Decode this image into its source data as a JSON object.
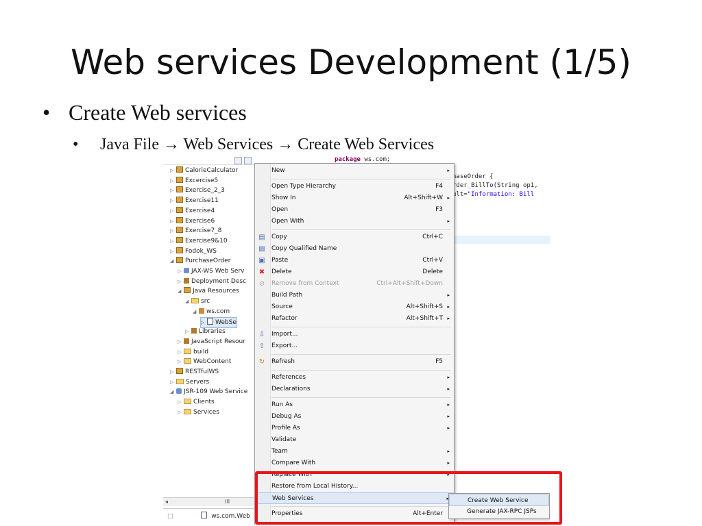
{
  "slide": {
    "title": "Web services Development (1/5)",
    "bullet1": "Create Web services",
    "bullet2": "Java File → Web Services → Create Web Services",
    "bullet_symbol": "•"
  },
  "explorer": {
    "items": [
      {
        "label": "CalorieCalculator",
        "icon": "project-icon",
        "indent": 0,
        "twisty": "▷"
      },
      {
        "label": "Excercise5",
        "icon": "project-icon",
        "indent": 0,
        "twisty": "▷"
      },
      {
        "label": "Exercise_2_3",
        "icon": "project-icon",
        "indent": 0,
        "twisty": "▷"
      },
      {
        "label": "Exercise11",
        "icon": "project-icon",
        "indent": 0,
        "twisty": "▷"
      },
      {
        "label": "Exercise4",
        "icon": "project-icon",
        "indent": 0,
        "twisty": "▷"
      },
      {
        "label": "Exercise6",
        "icon": "project-icon",
        "indent": 0,
        "twisty": "▷"
      },
      {
        "label": "Exercise7_8",
        "icon": "project-icon",
        "indent": 0,
        "twisty": "▷"
      },
      {
        "label": "Exercise9&10",
        "icon": "project-icon",
        "indent": 0,
        "twisty": "▷"
      },
      {
        "label": "Fodok_WS",
        "icon": "project-icon",
        "indent": 0,
        "twisty": "▷"
      },
      {
        "label": "PurchaseOrder",
        "icon": "project-icon",
        "indent": 0,
        "twisty": "◢"
      },
      {
        "label": "JAX-WS Web Serv",
        "icon": "webservice-icon",
        "indent": 1,
        "twisty": "▷"
      },
      {
        "label": "Deployment Desc",
        "icon": "deployment-icon",
        "indent": 1,
        "twisty": "▷"
      },
      {
        "label": "Java Resources",
        "icon": "java-resources-icon",
        "indent": 1,
        "twisty": "◢"
      },
      {
        "label": "src",
        "icon": "source-folder-icon",
        "indent": 2,
        "twisty": "◢"
      },
      {
        "label": "ws.com",
        "icon": "package-icon",
        "indent": 3,
        "twisty": "◢"
      },
      {
        "label": "WebSe",
        "icon": "java-file-icon",
        "indent": 4,
        "twisty": "▷",
        "selected": true
      },
      {
        "label": "Libraries",
        "icon": "library-icon",
        "indent": 2,
        "twisty": "▷"
      },
      {
        "label": "JavaScript Resour",
        "icon": "library-icon",
        "indent": 1,
        "twisty": "▷"
      },
      {
        "label": "build",
        "icon": "folder-icon",
        "indent": 1,
        "twisty": "▷"
      },
      {
        "label": "WebContent",
        "icon": "folder-icon",
        "indent": 1,
        "twisty": "▷"
      },
      {
        "label": "RESTfulWS",
        "icon": "project-icon",
        "indent": 0,
        "twisty": "▷"
      },
      {
        "label": "Servers",
        "icon": "folder-icon",
        "indent": 0,
        "twisty": "▷"
      },
      {
        "label": "JSR-109 Web Service",
        "icon": "webservice-icon",
        "indent": 0,
        "twisty": "◢"
      },
      {
        "label": "Clients",
        "icon": "folder-icon",
        "indent": 1,
        "twisty": "▷"
      },
      {
        "label": "Services",
        "icon": "folder-icon",
        "indent": 1,
        "twisty": "▷"
      }
    ],
    "scroll_left": "◂",
    "scroll_mid": "III",
    "status_file": "ws.com.Web"
  },
  "code": {
    "line1_kw": "package",
    "line1_rest": " ws.com;",
    "line2": "haseOrder {",
    "line3": "rder_BillTo(String op1,",
    "line4_pre": "ult=",
    "line4_str": "\"Information: Bill"
  },
  "context_menu": {
    "items": [
      {
        "label": "New",
        "shortcut": "",
        "submenu": true,
        "icon": ""
      },
      {
        "sep": true
      },
      {
        "label": "Open Type Hierarchy",
        "shortcut": "F4",
        "submenu": false,
        "icon": ""
      },
      {
        "label": "Show In",
        "shortcut": "Alt+Shift+W",
        "submenu": true,
        "icon": ""
      },
      {
        "label": "Open",
        "shortcut": "F3",
        "submenu": false,
        "icon": ""
      },
      {
        "label": "Open With",
        "shortcut": "",
        "submenu": true,
        "icon": ""
      },
      {
        "sep": true
      },
      {
        "label": "Copy",
        "shortcut": "Ctrl+C",
        "submenu": false,
        "icon": "copy-icon"
      },
      {
        "label": "Copy Qualified Name",
        "shortcut": "",
        "submenu": false,
        "icon": "copy-qualified-icon"
      },
      {
        "label": "Paste",
        "shortcut": "Ctrl+V",
        "submenu": false,
        "icon": "paste-icon"
      },
      {
        "label": "Delete",
        "shortcut": "Delete",
        "submenu": false,
        "icon": "delete-icon"
      },
      {
        "label": "Remove from Context",
        "shortcut": "Ctrl+Alt+Shift+Down",
        "submenu": false,
        "icon": "remove-context-icon",
        "disabled": true
      },
      {
        "label": "Build Path",
        "shortcut": "",
        "submenu": true,
        "icon": ""
      },
      {
        "label": "Source",
        "shortcut": "Alt+Shift+S",
        "submenu": true,
        "icon": ""
      },
      {
        "label": "Refactor",
        "shortcut": "Alt+Shift+T",
        "submenu": true,
        "icon": ""
      },
      {
        "sep": true
      },
      {
        "label": "Import...",
        "shortcut": "",
        "submenu": false,
        "icon": "import-icon"
      },
      {
        "label": "Export...",
        "shortcut": "",
        "submenu": false,
        "icon": "export-icon"
      },
      {
        "sep": true
      },
      {
        "label": "Refresh",
        "shortcut": "F5",
        "submenu": false,
        "icon": "refresh-icon"
      },
      {
        "sep": true
      },
      {
        "label": "References",
        "shortcut": "",
        "submenu": true,
        "icon": ""
      },
      {
        "label": "Declarations",
        "shortcut": "",
        "submenu": true,
        "icon": ""
      },
      {
        "sep": true
      },
      {
        "label": "Run As",
        "shortcut": "",
        "submenu": true,
        "icon": ""
      },
      {
        "label": "Debug As",
        "shortcut": "",
        "submenu": true,
        "icon": ""
      },
      {
        "label": "Profile As",
        "shortcut": "",
        "submenu": true,
        "icon": ""
      },
      {
        "label": "Validate",
        "shortcut": "",
        "submenu": false,
        "icon": ""
      },
      {
        "label": "Team",
        "shortcut": "",
        "submenu": true,
        "icon": ""
      },
      {
        "label": "Compare With",
        "shortcut": "",
        "submenu": true,
        "icon": ""
      },
      {
        "label": "Replace With",
        "shortcut": "",
        "submenu": true,
        "icon": ""
      },
      {
        "label": "Restore from Local History...",
        "shortcut": "",
        "submenu": false,
        "icon": ""
      },
      {
        "label": "Web Services",
        "shortcut": "",
        "submenu": true,
        "icon": "",
        "hover": true
      },
      {
        "sep": true
      },
      {
        "label": "Properties",
        "shortcut": "Alt+Enter",
        "submenu": false,
        "icon": ""
      }
    ],
    "submenu_arrow": "▸"
  },
  "web_services_submenu": {
    "items": [
      {
        "label": "Create Web Service",
        "hover": true
      },
      {
        "label": "Generate JAX-RPC JSPs"
      }
    ]
  },
  "colors": {
    "highlight_box": "#e8151c",
    "menu_hover": "#dfe9f6"
  }
}
